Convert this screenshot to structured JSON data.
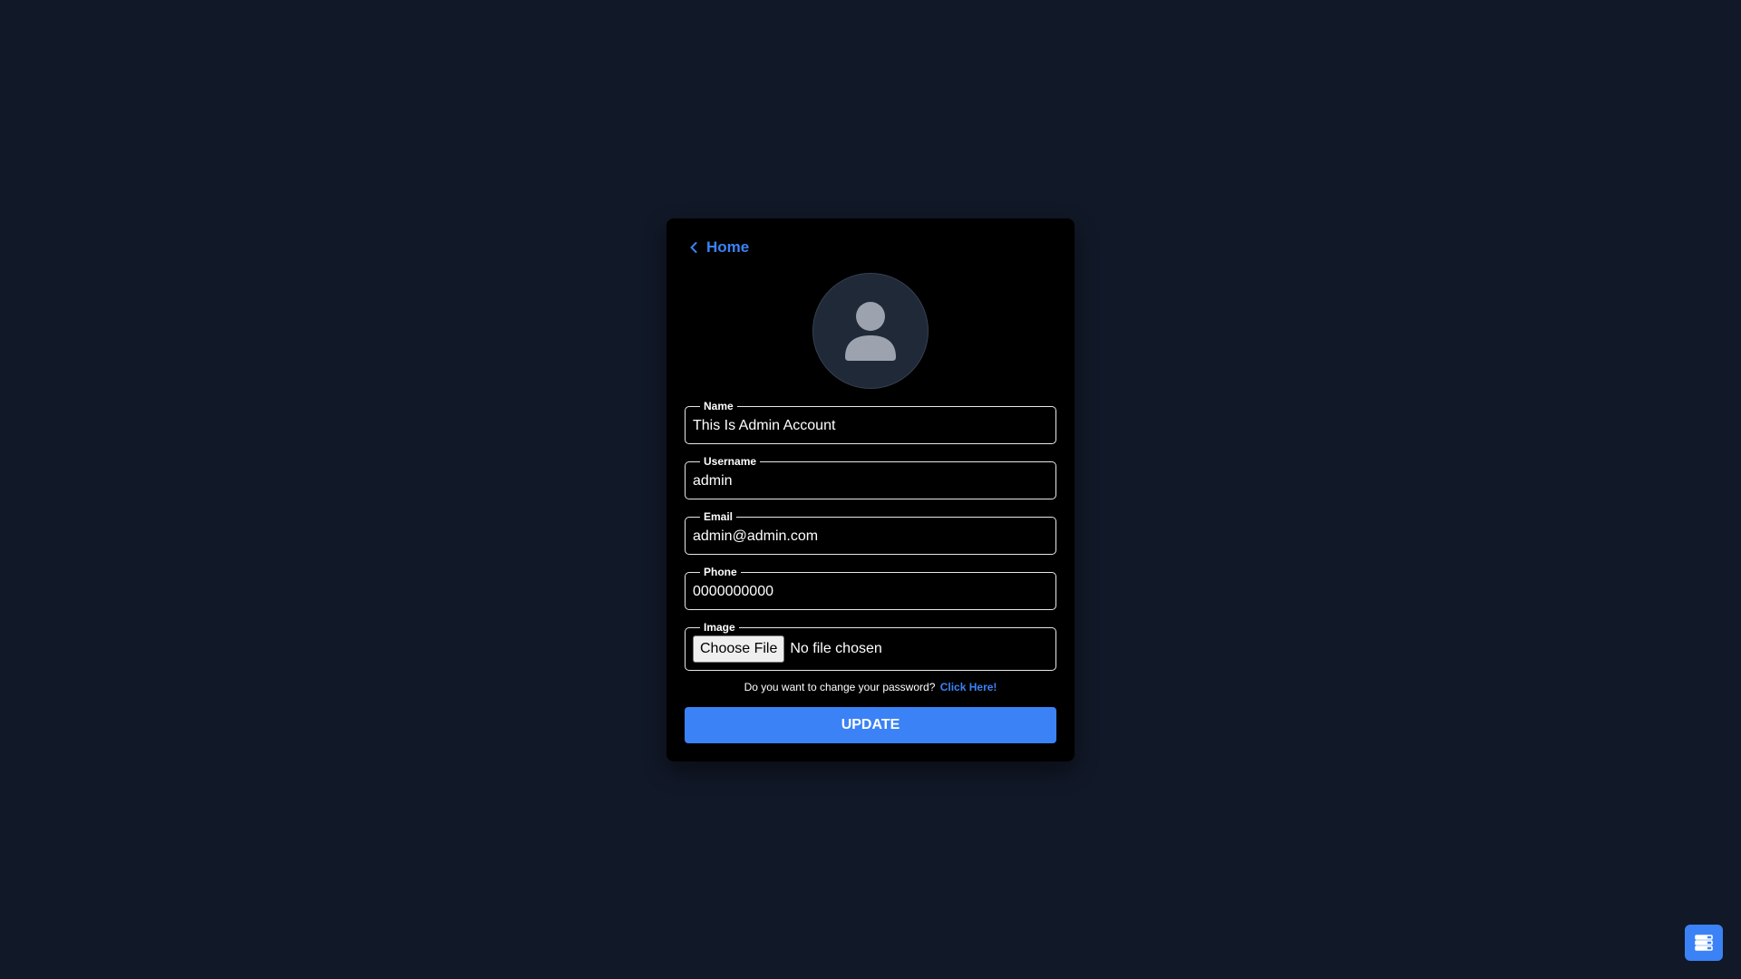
{
  "colors": {
    "page_background": "#111827",
    "card_background": "#000000",
    "accent": "#3b82f6",
    "avatar_background": "#1f2937",
    "avatar_icon": "#9ca3af"
  },
  "nav": {
    "back_icon": "chevron-left-icon",
    "home_label": "Home"
  },
  "profile": {
    "avatar_icon": "user-icon"
  },
  "form": {
    "name": {
      "label": "Name",
      "value": "This Is Admin Account"
    },
    "username": {
      "label": "Username",
      "value": "admin"
    },
    "email": {
      "label": "Email",
      "value": "admin@admin.com"
    },
    "phone": {
      "label": "Phone",
      "value": "0000000000"
    },
    "image": {
      "label": "Image",
      "button_label": "Choose File",
      "status": "No file chosen"
    },
    "password_prompt": "Do you want to change your password?",
    "password_link": "Click Here!",
    "submit_label": "UPDATE"
  },
  "floating_button": {
    "icon": "server-stack-icon"
  }
}
